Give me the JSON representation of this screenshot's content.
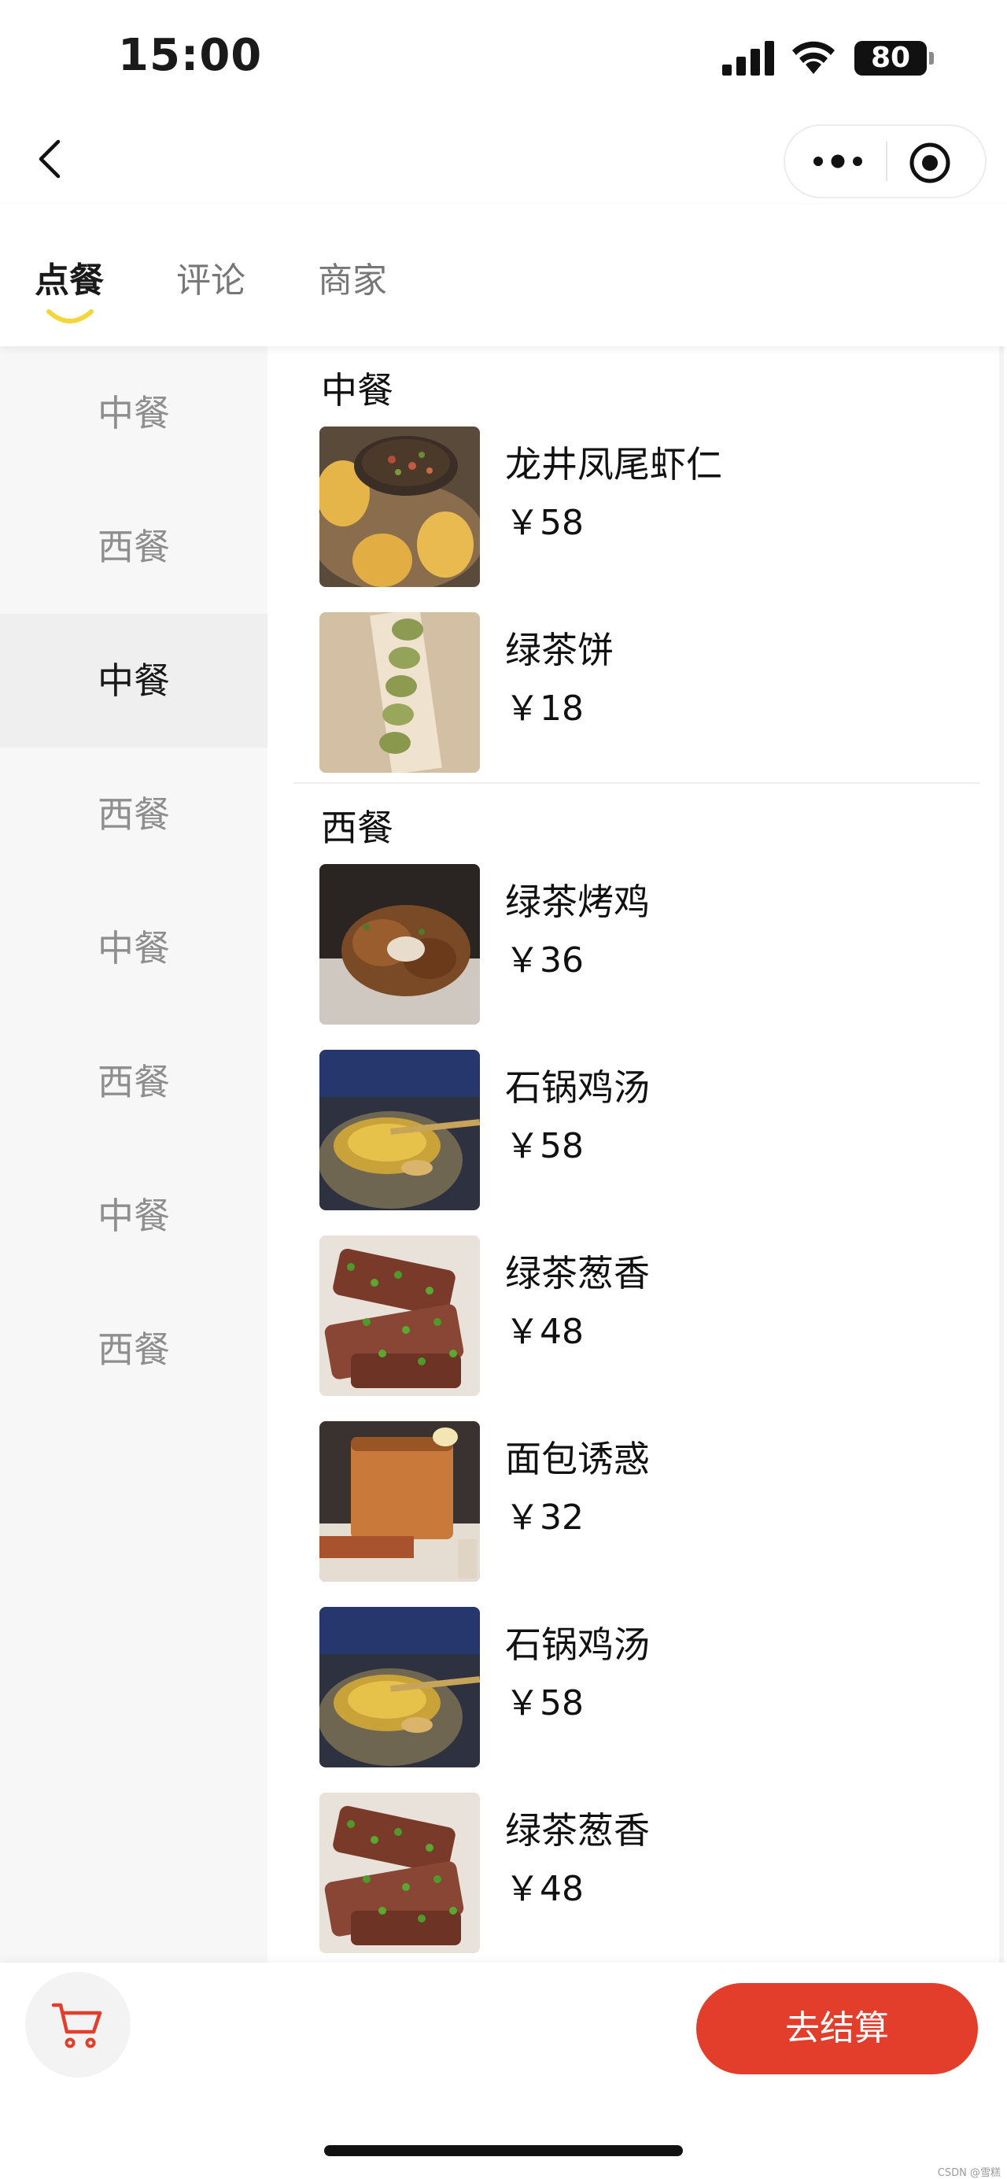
{
  "status_bar": {
    "time": "15:00",
    "battery": "80",
    "icons": [
      "signal-icon",
      "wifi-icon",
      "battery-icon"
    ]
  },
  "nav_bar": {
    "icons": [
      "back-icon",
      "more-icon",
      "close-circle-icon"
    ]
  },
  "tabs": [
    {
      "label": "点餐",
      "active": true
    },
    {
      "label": "评论",
      "active": false
    },
    {
      "label": "商家",
      "active": false
    }
  ],
  "sidebar": {
    "items": [
      {
        "label": "中餐"
      },
      {
        "label": "西餐"
      },
      {
        "label": "中餐",
        "active": true
      },
      {
        "label": "西餐"
      },
      {
        "label": "中餐"
      },
      {
        "label": "西餐"
      },
      {
        "label": "中餐"
      },
      {
        "label": "西餐"
      }
    ]
  },
  "sections": [
    {
      "title": "中餐",
      "dishes": [
        {
          "name": "龙井凤尾虾仁",
          "price": "￥58"
        },
        {
          "name": "绿茶饼",
          "price": "￥18"
        }
      ]
    },
    {
      "title": "西餐",
      "dishes": [
        {
          "name": "绿茶烤鸡",
          "price": "￥36"
        },
        {
          "name": "石锅鸡汤",
          "price": "￥58"
        },
        {
          "name": "绿茶葱香",
          "price": "￥48"
        },
        {
          "name": "面包诱惑",
          "price": "￥32"
        },
        {
          "name": "石锅鸡汤",
          "price": "￥58"
        },
        {
          "name": "绿茶葱香",
          "price": "￥48"
        }
      ]
    }
  ],
  "bottom_bar": {
    "checkout_label": "去结算",
    "cart_icon": "cart-icon"
  },
  "colors": {
    "accent": "#e33d2c",
    "tab_indicator": "#f5d63a",
    "sidebar_bg": "#f7f7f7",
    "sidebar_active_bg": "#efefef"
  },
  "watermark": "CSDN @雪糕"
}
